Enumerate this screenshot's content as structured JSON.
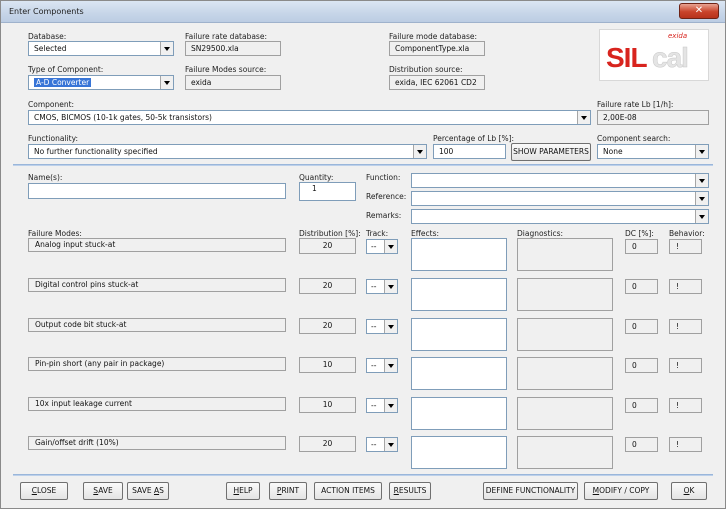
{
  "window": {
    "title": "Enter Components",
    "close_glyph": "✕"
  },
  "logo": {
    "main": "SIL",
    "accent": "cal",
    "brand": "exida",
    "accent_color": "#d8241e"
  },
  "header": {
    "database_label": "Database:",
    "database_value": "Selected",
    "failure_rate_db_label": "Failure rate database:",
    "failure_rate_db_value": "SN29500.xla",
    "failure_mode_db_label": "Failure mode database:",
    "failure_mode_db_value": "ComponentType.xla",
    "type_label": "Type of Component:",
    "type_value": "A-D Converter",
    "fm_source_label": "Failure Modes source:",
    "fm_source_value": "exida",
    "dist_source_label": "Distribution source:",
    "dist_source_value": "exida, IEC 62061 CD2",
    "component_label": "Component:",
    "component_value": "CMOS, BICMOS (10-1k gates, 50-5k transistors)",
    "failure_rate_label": "Failure rate Lb [1/h]:",
    "failure_rate_value": "2,00E-08",
    "functionality_label": "Functionality:",
    "functionality_value": "No further functionality specified",
    "percentage_label": "Percentage of Lb [%]:",
    "percentage_value": "100",
    "show_params_label": "SHOW PARAMETERS",
    "search_label": "Component search:",
    "search_value": "None"
  },
  "details": {
    "names_label": "Name(s):",
    "names_value": "",
    "quantity_label": "Quantity:",
    "quantity_value": "1",
    "function_label": "Function:",
    "reference_label": "Reference:",
    "remarks_label": "Remarks:"
  },
  "columns": {
    "failure_modes": "Failure Modes:",
    "distribution": "Distribution [%]:",
    "track": "Track:",
    "effects": "Effects:",
    "diagnostics": "Diagnostics:",
    "dc": "DC [%]:",
    "behavior": "Behavior:"
  },
  "failure_modes": [
    {
      "name": "Analog input stuck-at",
      "distribution": "20",
      "track": "--",
      "dc": "0",
      "behavior": "!"
    },
    {
      "name": "Digital control pins stuck-at",
      "distribution": "20",
      "track": "--",
      "dc": "0",
      "behavior": "!"
    },
    {
      "name": "Output code bit stuck-at",
      "distribution": "20",
      "track": "--",
      "dc": "0",
      "behavior": "!"
    },
    {
      "name": "Pin-pin short (any pair in package)",
      "distribution": "10",
      "track": "--",
      "dc": "0",
      "behavior": "!"
    },
    {
      "name": "10x input leakage current",
      "distribution": "10",
      "track": "--",
      "dc": "0",
      "behavior": "!"
    },
    {
      "name": "Gain/offset drift (10%)",
      "distribution": "20",
      "track": "--",
      "dc": "0",
      "behavior": "!"
    }
  ],
  "buttons": {
    "close": {
      "u": "C",
      "rest": "LOSE"
    },
    "save": {
      "u": "S",
      "rest": "AVE"
    },
    "save_as": {
      "pre": "SAVE ",
      "u": "A",
      "rest": "S"
    },
    "help": {
      "u": "H",
      "rest": "ELP"
    },
    "print": {
      "u": "P",
      "rest": "RINT"
    },
    "action_items": {
      "label": "ACTION ITEMS"
    },
    "results": {
      "u": "R",
      "rest": "ESULTS"
    },
    "define_functionality": {
      "pre": "DEFINE FUNCTIONALITY"
    },
    "modify_copy": {
      "u": "M",
      "rest": "ODIFY / COPY"
    },
    "ok": {
      "u": "O",
      "rest": "K"
    }
  }
}
